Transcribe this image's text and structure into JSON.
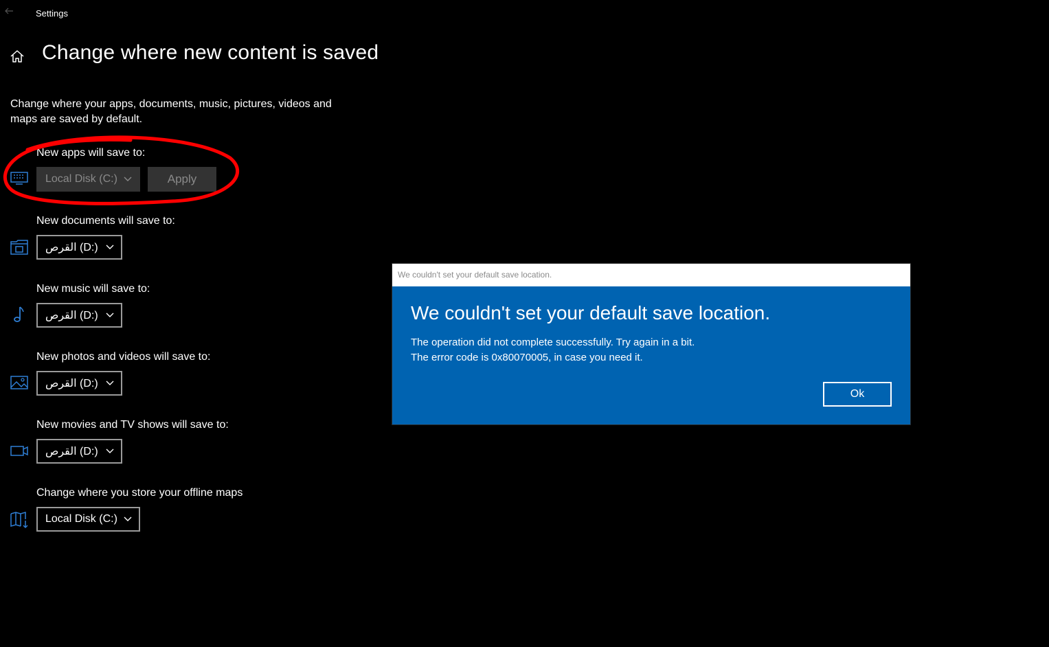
{
  "window": {
    "title": "Settings"
  },
  "page": {
    "title": "Change where new content is saved",
    "description": "Change where your apps, documents, music, pictures, videos and maps are saved by default."
  },
  "sections": [
    {
      "label": "New apps will save to:",
      "icon": "monitor-icon",
      "value": "Local Disk (C:)",
      "apply_label": "Apply",
      "disabled": true
    },
    {
      "label": "New documents will save to:",
      "icon": "documents-folder-icon",
      "value": "القرص (D:)"
    },
    {
      "label": "New music will save to:",
      "icon": "music-note-icon",
      "value": "القرص (D:)"
    },
    {
      "label": "New photos and videos will save to:",
      "icon": "picture-icon",
      "value": "القرص (D:)"
    },
    {
      "label": "New movies and TV shows will save to:",
      "icon": "video-camera-icon",
      "value": "القرص (D:)"
    },
    {
      "label": "Change where you store your offline maps",
      "icon": "map-download-icon",
      "value": "Local Disk (C:)"
    }
  ],
  "dialog": {
    "titlebar": "We couldn't set your default save location.",
    "heading": "We couldn't set your default save location.",
    "line1": "The operation did not complete successfully. Try again in a bit.",
    "line2": "The error code is 0x80070005, in case you need it.",
    "ok_label": "Ok"
  },
  "colors": {
    "accent": "#0063b1",
    "icon": "#2f7fd6",
    "annotation": "#ff0000"
  }
}
